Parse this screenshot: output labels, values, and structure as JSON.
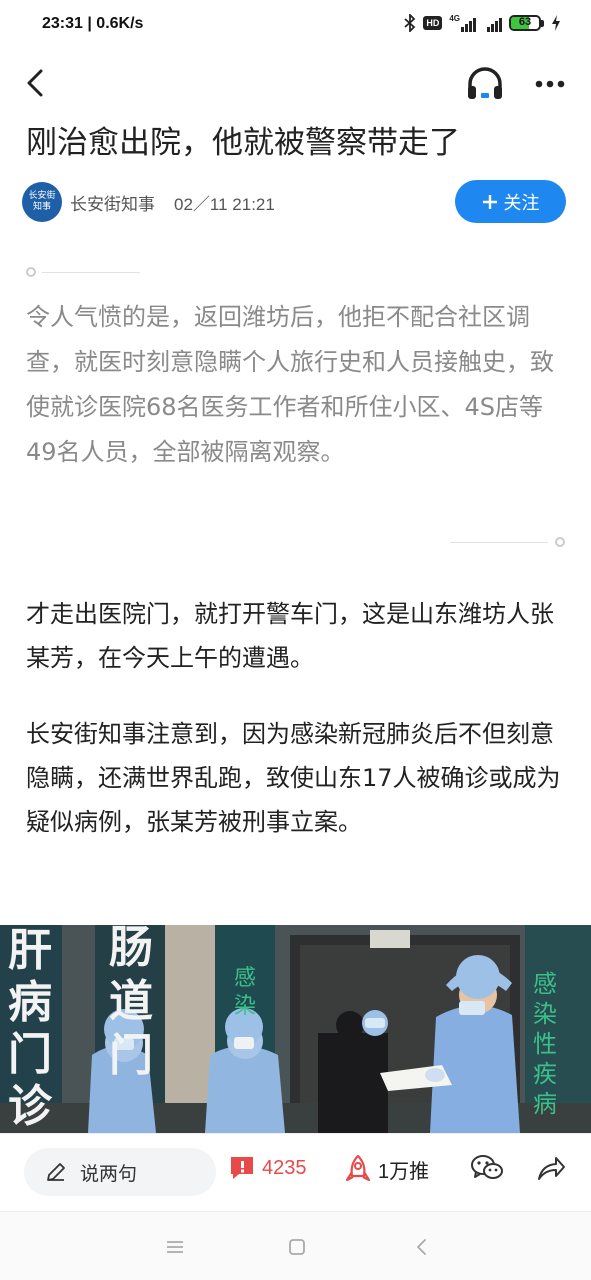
{
  "status_bar": {
    "time_speed": "23:31 | 0.6K/s",
    "network_type": "4G",
    "hd_label": "HD",
    "battery_percent": 63
  },
  "nav": {
    "back_icon": "chevron-left-icon",
    "audio_icon": "headphones-icon",
    "more_icon": "more-dots-icon"
  },
  "article": {
    "title": "刚治愈出院，他就被警察带走了",
    "author": {
      "name": "长安街知事",
      "time": "02／11 21:21",
      "avatar_text": "长安街知事"
    },
    "follow_button": {
      "label": "关注",
      "icon": "plus"
    },
    "quote": "令人气愤的是，返回潍坊后，他拒不配合社区调查，就医时刻意隐瞒个人旅行史和人员接触史，致使就诊医院68名医务工作者和所住小区、4S店等49名人员，全部被隔离观察。",
    "paragraphs": [
      "才走出医院门，就打开警车门，这是山东潍坊人张某芳，在今天上午的遭遇。",
      "长安街知事注意到，因为感染新冠肺炎后不但刻意隐瞒，还满世界乱跑，致使山东17人被确诊或成为疑似病例，张某芳被刑事立案。"
    ],
    "photo": {
      "signs_left": [
        "肝",
        "病",
        "门",
        "诊"
      ],
      "signs_mid": [
        "肠",
        "道",
        "门"
      ],
      "signs_right_green": [
        "感",
        "染",
        "性",
        "疾",
        "病"
      ],
      "signs_door_green": [
        "感",
        "染"
      ]
    }
  },
  "action_bar": {
    "comment_placeholder": "说两句",
    "comment_count": "4235",
    "push_label": "1万推",
    "wechat_icon": "wechat-icon",
    "share_icon": "share-icon"
  },
  "system_nav": {
    "menu_icon": "menu-icon",
    "home_icon": "home-square-icon",
    "back_icon": "back-triangle-icon"
  },
  "colors": {
    "accent_blue": "#1e88f0",
    "count_red": "#e84a4a",
    "quote_gray": "#8a8a8a",
    "battery_green": "#3ec43e"
  }
}
